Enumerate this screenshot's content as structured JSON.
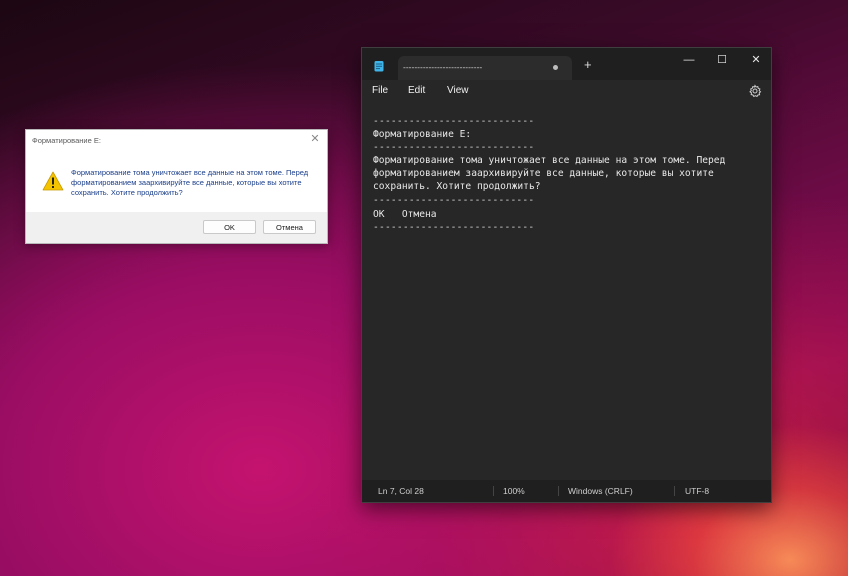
{
  "dialog": {
    "title": "Форматирование E:",
    "message": "Форматирование тома уничтожает все данные на этом томе. Перед форматированием заархивируйте все данные, которые вы хотите сохранить. Хотите продолжить?",
    "ok_label": "OK",
    "cancel_label": "Отмена",
    "close_glyph": "✕",
    "icon": "warning-icon"
  },
  "notepad": {
    "tab_title": "----------------------------",
    "new_tab_glyph": "+",
    "window_controls": {
      "minimize": "—",
      "maximize": "☐",
      "close": "✕"
    },
    "menu": {
      "file": "File",
      "edit": "Edit",
      "view": "View"
    },
    "editor_lines": [
      "---------------------------",
      "Форматирование E:",
      "---------------------------",
      "Форматирование тома уничтожает все данные на этом томе. Перед",
      "форматированием заархивируйте все данные, которые вы хотите",
      "сохранить. Хотите продолжить?",
      "---------------------------",
      "OK   Отмена",
      "---------------------------"
    ],
    "status": {
      "position": "Ln 7, Col 28",
      "zoom": "100%",
      "line_ending": "Windows (CRLF)",
      "encoding": "UTF-8"
    }
  },
  "colors": {
    "accent_warning": "#f5c400",
    "notepad_bg": "#272727",
    "dialog_text": "#1a3e8a"
  }
}
